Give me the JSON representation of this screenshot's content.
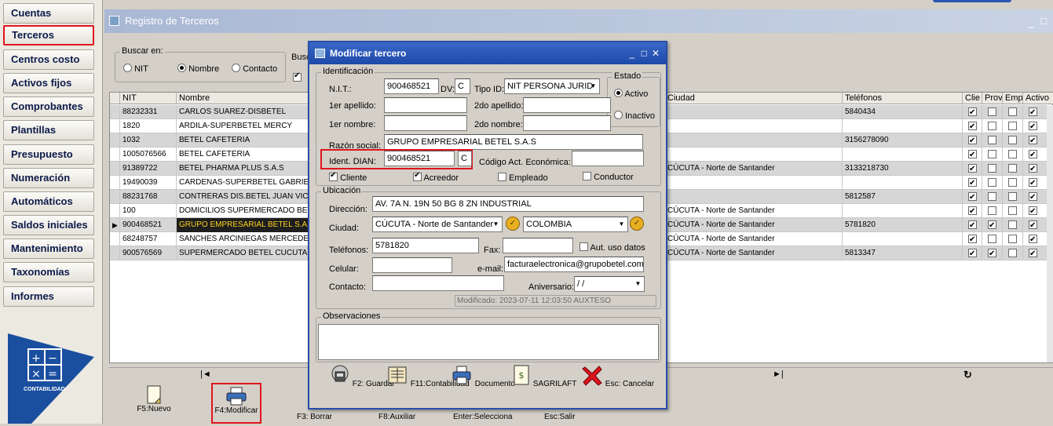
{
  "menu": {
    "items": [
      "Cuentas",
      "Terceros",
      "Centros costo",
      "Activos fijos",
      "Comprobantes",
      "Plantillas",
      "Presupuesto",
      "Numeración",
      "Automáticos",
      "Saldos iniciales",
      "Mantenimiento",
      "Taxonomías",
      "Informes"
    ],
    "selected": "Terceros",
    "logo_text": "CONTABILIDAD"
  },
  "bg_window": {
    "title": "Registro de Terceros",
    "search_in_label": "Buscar en:",
    "search_options": [
      "NIT",
      "Nombre",
      "Contacto"
    ],
    "search_selected": "Nombre",
    "search_label_cut": "Busc"
  },
  "grid": {
    "columns": [
      "NIT",
      "Nombre",
      "Ciudad",
      "Teléfonos",
      "Clie",
      "Prov",
      "Emp",
      "Activo"
    ],
    "rows": [
      {
        "nit": "88232331",
        "nombre": " CARLOS SUAREZ-DISBETEL",
        "ciudad": "",
        "tel": "5840434",
        "clie": true,
        "prov": false,
        "emp": false,
        "act": true
      },
      {
        "nit": "1820",
        "nombre": "ARDILA-SUPERBETEL MERCY",
        "ciudad": "",
        "tel": "",
        "clie": true,
        "prov": false,
        "emp": false,
        "act": true
      },
      {
        "nit": "1032",
        "nombre": "BETEL CAFETERIA",
        "ciudad": "",
        "tel": "3156278090",
        "clie": true,
        "prov": false,
        "emp": false,
        "act": true
      },
      {
        "nit": "1005076566",
        "nombre": "BETEL CAFETERIA",
        "ciudad": "",
        "tel": "",
        "clie": true,
        "prov": false,
        "emp": false,
        "act": true
      },
      {
        "nit": "91389722",
        "nombre": "BETEL PHARMA PLUS S.A.S",
        "ciudad": "CÚCUTA - Norte de Santander",
        "tel": "3133218730",
        "clie": true,
        "prov": false,
        "emp": false,
        "act": true
      },
      {
        "nit": "19490039",
        "nombre": "CARDENAS-SUPERBETEL GABRIEL",
        "ciudad": "",
        "tel": "",
        "clie": true,
        "prov": false,
        "emp": false,
        "act": true
      },
      {
        "nit": "88231768",
        "nombre": "CONTRERAS DIS.BETEL JUAN VICEN",
        "ciudad": "",
        "tel": "5812587",
        "clie": true,
        "prov": false,
        "emp": false,
        "act": true
      },
      {
        "nit": "100",
        "nombre": "DOMICILIOS SUPERMERCADO BETEL",
        "ciudad": "CÚCUTA - Norte de Santander",
        "tel": "",
        "clie": true,
        "prov": false,
        "emp": false,
        "act": true
      },
      {
        "nit": "900468521",
        "nombre": "GRUPO EMPRESARIAL BETEL S.A.S",
        "ciudad": "CÚCUTA - Norte de Santander",
        "tel": "5781820",
        "clie": true,
        "prov": true,
        "emp": false,
        "act": true
      },
      {
        "nit": "68248757",
        "nombre": "SANCHES ARCINIEGAS MERCEDES B",
        "ciudad": "CÚCUTA - Norte de Santander",
        "tel": "",
        "clie": true,
        "prov": false,
        "emp": false,
        "act": true
      },
      {
        "nit": "900576569",
        "nombre": "SUPERMERCADO BETEL CUCUTA S.",
        "ciudad": "CÚCUTA - Norte de Santander",
        "tel": "5813347",
        "clie": true,
        "prov": true,
        "emp": false,
        "act": true
      }
    ]
  },
  "toolbar": {
    "buttons": [
      "F5:Nuevo",
      "F4:Modificar",
      "F3: Borrar",
      "F8:Auxiliar",
      "Enter:Selecciona",
      "Esc:Salir"
    ]
  },
  "dialog": {
    "title": "Modificar tercero",
    "identificacion": "Identificación",
    "nit_label": "N.I.T.:",
    "nit": "900468521",
    "dv_label": "DV:",
    "dv": "C",
    "tipo_id_label": "Tipo ID:",
    "tipo_id": "NIT PERSONA JURID",
    "apellido1_label": "1er apellido:",
    "apellido2_label": "2do apellido:",
    "nombre1_label": "1er nombre:",
    "nombre2_label": "2do nombre:",
    "razon_label": "Razón social:",
    "razon": "GRUPO EMPRESARIAL BETEL S.A.S",
    "ident_dian_label": "Ident. DIAN:",
    "ident_dian": "900468521",
    "ident_dv": "C",
    "codigo_label": "Código Act. Económica:",
    "estado_label": "Estado",
    "activo": "Activo",
    "inactivo": "Inactivo",
    "cliente": "Cliente",
    "acreedor": "Acreedor",
    "empleado": "Empleado",
    "conductor": "Conductor",
    "ubicacion": "Ubicación",
    "direccion_label": "Dirección:",
    "direccion": "AV. 7A N. 19N 50 BG 8 ZN INDUSTRIAL",
    "ciudad_label": "Ciudad:",
    "ciudad": "CÚCUTA - Norte de Santander",
    "pais": "COLOMBIA",
    "telefonos_label": "Teléfonos:",
    "telefonos": "5781820",
    "fax_label": "Fax:",
    "aut_label": "Aut. uso datos",
    "celular_label": "Celular:",
    "email_label": "e-mail:",
    "email": "facturaelectronica@grupobetel.com.",
    "contacto_label": "Contacto:",
    "aniversario_label": "Aniversario:",
    "aniversario": " /  /",
    "modificado": "Modificado: 2023-07-11  12:03:50  AUXTESO",
    "observaciones": "Observaciones",
    "buttons": [
      "F2: Guardar",
      "F11:Contabilidad",
      "Documento",
      "SAGRILAFT",
      "Esc: Cancelar"
    ]
  }
}
